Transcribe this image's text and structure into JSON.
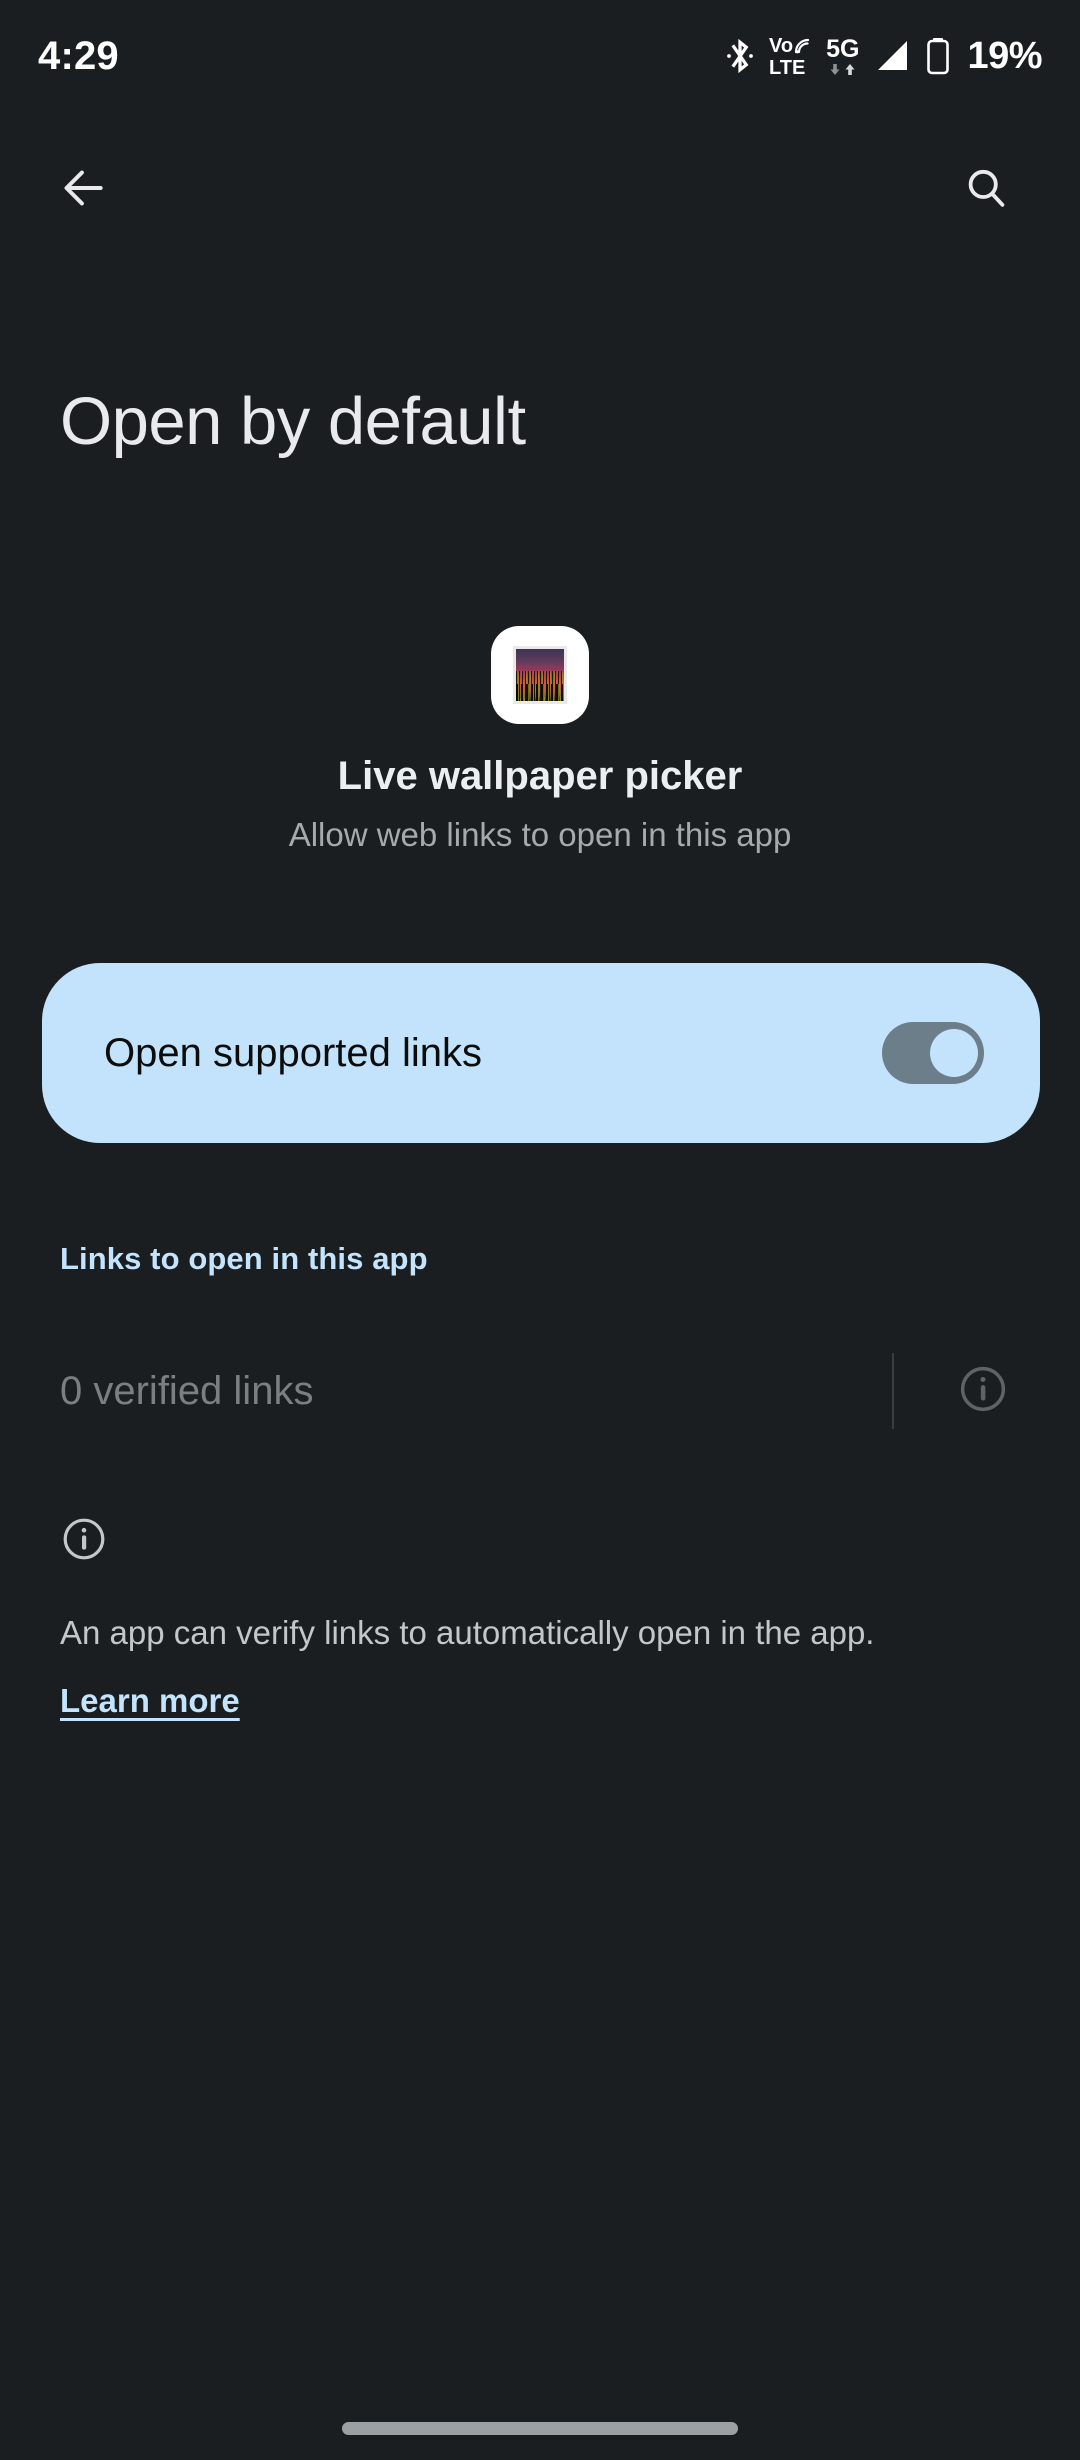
{
  "status_bar": {
    "time": "4:29",
    "battery_percent": "19%",
    "network_label_top": "Vo",
    "network_label_bottom": "LTE",
    "data_label": "5G",
    "icons": [
      "bluetooth-icon",
      "volte-icon",
      "5g-icon",
      "signal-icon",
      "battery-icon"
    ]
  },
  "app_bar": {
    "back_icon": "back-arrow-icon",
    "search_icon": "search-icon"
  },
  "page": {
    "title": "Open by default"
  },
  "app_header": {
    "icon_name": "live-wallpaper-picker-app-icon",
    "name": "Live wallpaper picker",
    "subtitle": "Allow web links to open in this app"
  },
  "toggle_card": {
    "label": "Open supported links",
    "state": "on",
    "background_color": "#c2e3fb",
    "track_color": "#6c7e8a",
    "knob_color": "#c2e3fb",
    "text_color": "#0d0d0d"
  },
  "links_section": {
    "header": "Links to open in this app",
    "row_label": "0 verified links",
    "row_info_icon": "info-icon",
    "header_color": "#c3e4fc",
    "row_label_color": "#797f83"
  },
  "footer": {
    "icon": "info-icon",
    "text": "An app can verify links to automatically open in the app.",
    "link_label": "Learn more",
    "link_color": "#c3e4fc"
  },
  "nav_bar": {
    "handle": "gesture-nav-handle"
  },
  "theme": {
    "background": "#1b1e20",
    "accent_blue": "#c2e3fb",
    "primary_text": "#e8eaed",
    "secondary_text": "#a5aaae"
  }
}
